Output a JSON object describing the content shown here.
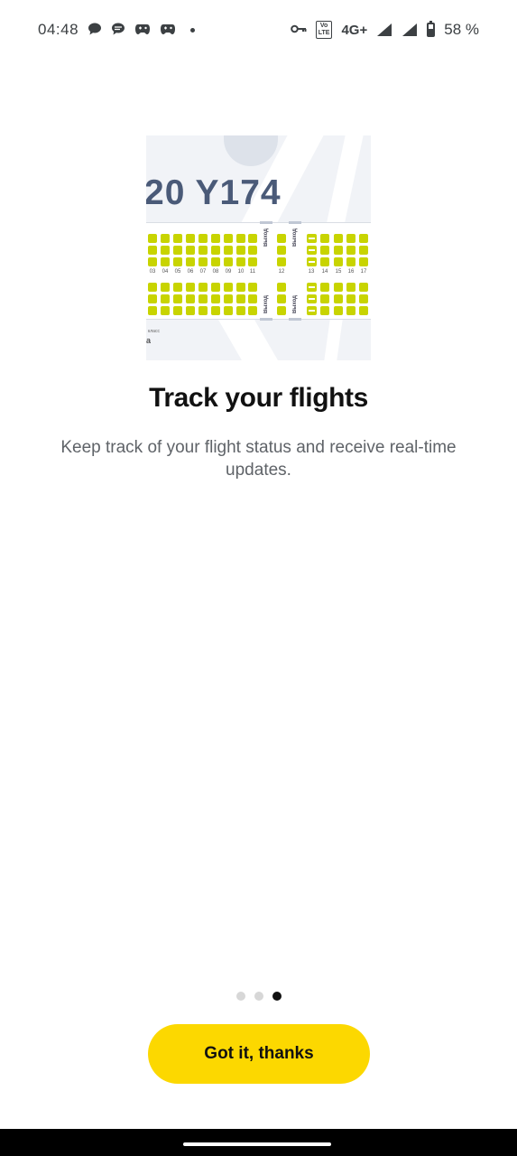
{
  "status_bar": {
    "time": "04:48",
    "network": "4G+",
    "volte_line1": "Vo",
    "volte_line2": "LTE",
    "battery_percent": "58 %",
    "battery_level": 0.58,
    "left_icons": [
      "chat-bubble-icon",
      "chat-bubble-icon",
      "game-controller-icon",
      "game-controller-icon",
      "dot-icon"
    ],
    "right_icons": [
      "vpn-key-icon",
      "volte-icon",
      "signal-icon",
      "signal-icon",
      "battery-icon"
    ]
  },
  "illustration": {
    "aircraft_code": "20 Y174",
    "row_numbers": [
      "03",
      "04",
      "05",
      "06",
      "07",
      "08",
      "09",
      "10",
      "11",
      "12",
      "13",
      "14",
      "15",
      "16",
      "17"
    ],
    "exit_label": "Выход",
    "class_label": "класс",
    "class_sub": "а",
    "seat_color": "#c8d400"
  },
  "onboarding": {
    "title": "Track your flights",
    "description": "Keep track of your flight status and receive real-time updates.",
    "page_count": 3,
    "active_page": 3
  },
  "cta": {
    "label": "Got it, thanks",
    "color": "#fcd800"
  }
}
